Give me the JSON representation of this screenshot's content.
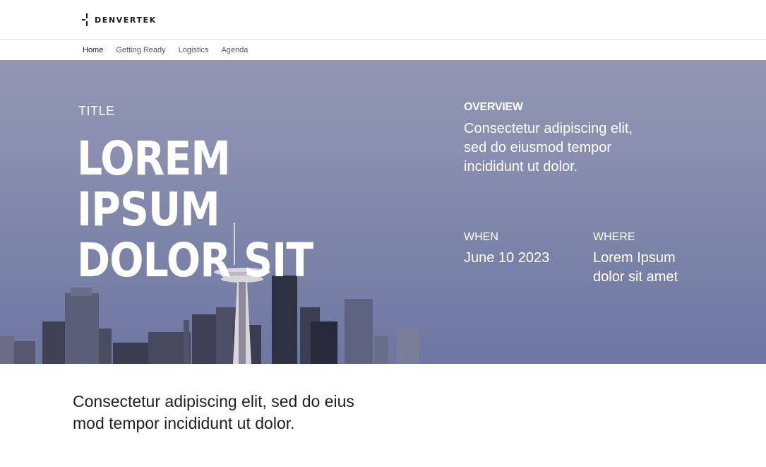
{
  "brand": {
    "name": "DENVERTEK",
    "logo_icon": "denvertek-logo-icon"
  },
  "nav": {
    "items": [
      {
        "label": "Home",
        "active": true
      },
      {
        "label": "Getting Ready",
        "active": false
      },
      {
        "label": "Logistics",
        "active": false
      },
      {
        "label": "Agenda",
        "active": false
      }
    ]
  },
  "hero": {
    "eyebrow": "TITLE",
    "headline_line1": "LOREM IPSUM",
    "headline_line2": "DOLOR SIT",
    "overview_label": "OVERVIEW",
    "overview_text": "Consectetur adipiscing elit, sed do eiusmod tempor incididunt ut dolor.",
    "when_label": "WHEN",
    "when_value": "June 10 2023",
    "where_label": "WHERE",
    "where_value": "Lorem Ipsum dolor sit amet",
    "background": "city-skyline-image"
  },
  "intro": {
    "text": "Consectetur adipiscing elit, sed do eius mod tempor incididunt ut dolor."
  },
  "colors": {
    "hero_top": "#9396b3",
    "hero_bottom": "#6d77a2",
    "text_dark": "#1f1f1f",
    "hero_text": "#ffffff"
  }
}
